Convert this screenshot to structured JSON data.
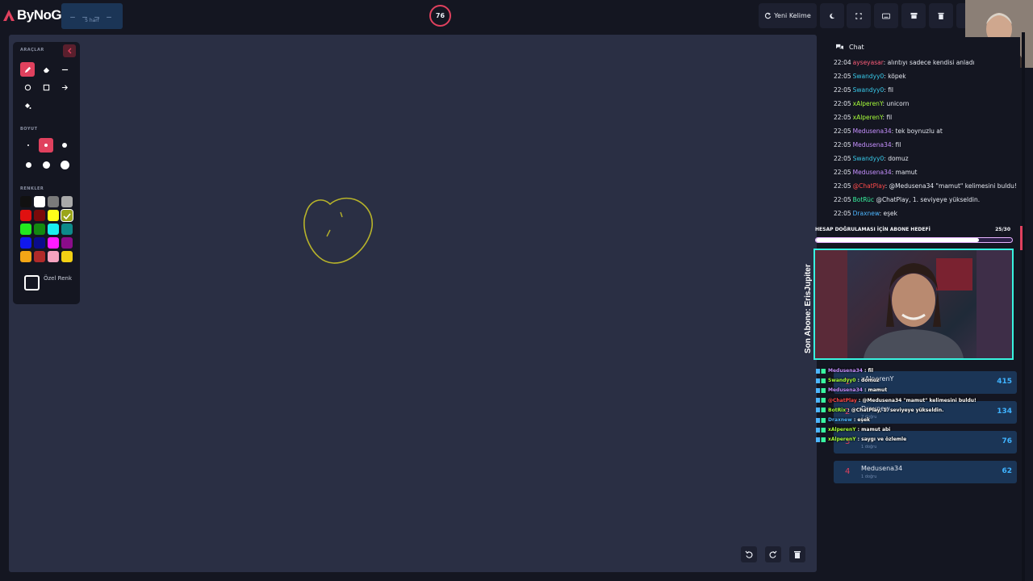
{
  "header": {
    "logo_text": "ByNoGame",
    "word_hint": "_ _ _ _",
    "word_length": "5 harf",
    "timer": "76",
    "new_word_label": "Yeni Kelime"
  },
  "tools": {
    "section_tools": "ARAÇLAR",
    "section_size": "BOYUT",
    "section_colors": "RENKLER",
    "custom_color_label": "Özel Renk",
    "colors": [
      "#111111",
      "#ffffff",
      "#7a7a7a",
      "#a9a9a9",
      "#e01010",
      "#7a0a0a",
      "#ffff1a",
      "#9aa51a",
      "#22e81e",
      "#138a10",
      "#19f0f0",
      "#0c8a8a",
      "#1018ee",
      "#0b0c8a",
      "#ff1aff",
      "#8a0c8a",
      "#f2a516",
      "#b02a2a",
      "#f5a3c0",
      "#f2d014"
    ],
    "selected_color": "#9aa51a"
  },
  "chat": {
    "title": "Chat",
    "messages": [
      {
        "time": "22:04",
        "user": "ayseyasar",
        "color": "#ff5d7a",
        "text": ": alıntıyı sadece kendisi anladı"
      },
      {
        "time": "22:05",
        "user": "Swandyy0",
        "color": "#38c8e8",
        "text": ": köpek"
      },
      {
        "time": "22:05",
        "user": "Swandyy0",
        "color": "#38c8e8",
        "text": ": fil"
      },
      {
        "time": "22:05",
        "user": "xAlperenY",
        "color": "#a8ff3a",
        "text": ": unicorn"
      },
      {
        "time": "22:05",
        "user": "xAlperenY",
        "color": "#a8ff3a",
        "text": ": fil"
      },
      {
        "time": "22:05",
        "user": "Medusena34",
        "color": "#c690ff",
        "text": ": tek boynuzlu at"
      },
      {
        "time": "22:05",
        "user": "Medusena34",
        "color": "#c690ff",
        "text": ": fil"
      },
      {
        "time": "22:05",
        "user": "Swandyy0",
        "color": "#38c8e8",
        "text": ": domuz"
      },
      {
        "time": "22:05",
        "user": "Medusena34",
        "color": "#c690ff",
        "text": ": mamut"
      },
      {
        "time": "22:05",
        "user": "@ChatPlay",
        "color": "#ff4a4a",
        "text": ": @Medusena34 \"mamut\" kelimesini buldu!"
      },
      {
        "time": "22:05",
        "user": "BotRüc",
        "color": "#38f4a0",
        "text": " @ChatPlay, 1. seviyeye yükseldin."
      },
      {
        "time": "22:05",
        "user": "Draxnew",
        "color": "#4db6ff",
        "text": ": eşek"
      }
    ]
  },
  "overlay": {
    "goal_title": "HESAP DOĞRULAMASI İÇİN ABONE HEDEFİ",
    "goal_count": "25/30",
    "goal_fraction": 0.83,
    "last_sub": "Son Abone: ErisJupiter",
    "messages": [
      {
        "user": "Medusena34",
        "color": "#c690ff",
        "text": " : fil"
      },
      {
        "user": "Swandyy0",
        "color": "#a8ff3a",
        "text": " : domuz"
      },
      {
        "user": "Medusena34",
        "color": "#c690ff",
        "text": " : mamut"
      },
      {
        "user": "@ChatPlay",
        "color": "#ff4a4a",
        "text": " : @Medusena34 \"mamut\" kelimesini buldu!"
      },
      {
        "user": "BotRix",
        "color": "#a8ff3a",
        "text": " : @ChatPlay, 1. seviyeye yükseldin."
      },
      {
        "user": "Draxnew",
        "color": "#4db6ff",
        "text": " : eşek"
      },
      {
        "user": "xAlperenY",
        "color": "#a8ff3a",
        "text": " : mamut abi"
      },
      {
        "user": "xAlperenY",
        "color": "#a8ff3a",
        "text": " : saygı ve özlemle"
      }
    ]
  },
  "leaderboard": [
    {
      "rank": "1",
      "name": "xAlperenY",
      "sub": "",
      "score": "415"
    },
    {
      "rank": "2",
      "name": "Draxnew",
      "sub": "2 doğru",
      "score": "134"
    },
    {
      "rank": "3",
      "name": "",
      "sub": "1 doğru",
      "score": "76"
    },
    {
      "rank": "4",
      "name": "Medusena34",
      "sub": "1 doğru",
      "score": "62"
    }
  ]
}
